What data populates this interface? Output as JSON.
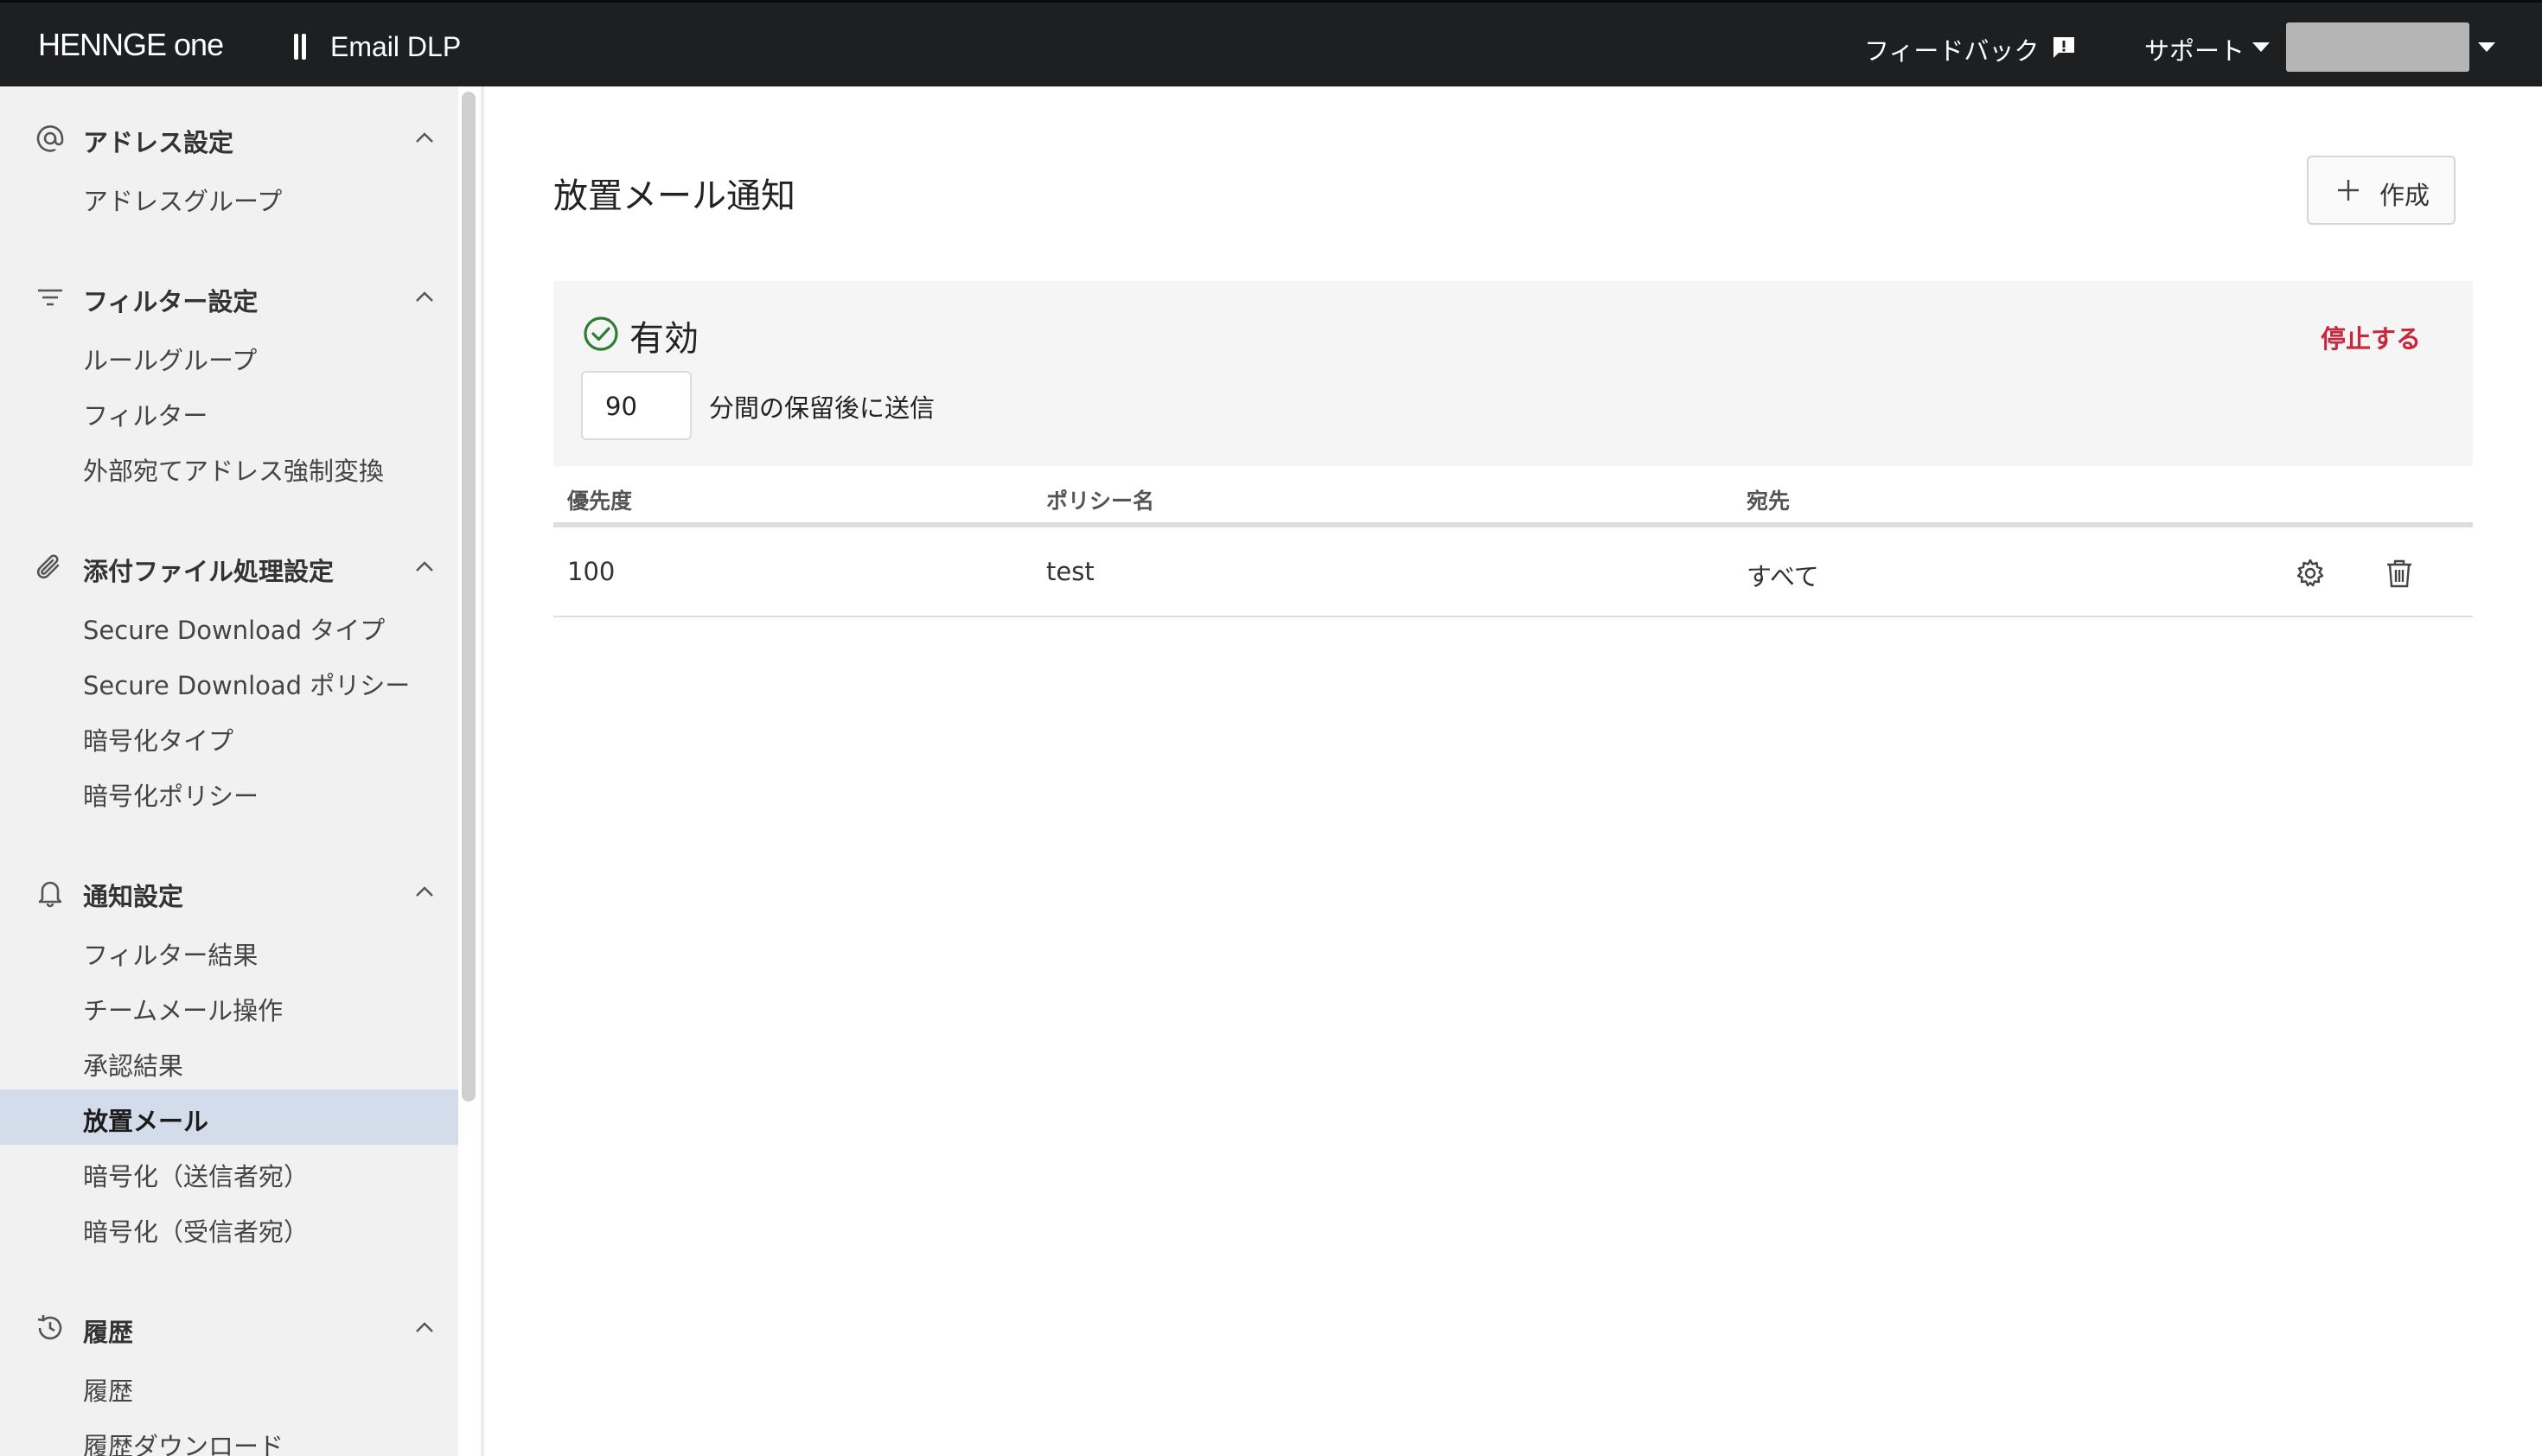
{
  "header": {
    "brand": "HENNGE one",
    "product": "Email DLP",
    "feedback_label": "フィードバック",
    "support_label": "サポート"
  },
  "sidebar": {
    "sections": [
      {
        "label": "アドレス設定",
        "icon": "at-icon",
        "items": [
          "アドレスグループ"
        ]
      },
      {
        "label": "フィルター設定",
        "icon": "filter-icon",
        "items": [
          "ルールグループ",
          "フィルター",
          "外部宛てアドレス強制変換"
        ]
      },
      {
        "label": "添付ファイル処理設定",
        "icon": "paperclip-icon",
        "items": [
          "Secure Download タイプ",
          "Secure Download ポリシー",
          "暗号化タイプ",
          "暗号化ポリシー"
        ]
      },
      {
        "label": "通知設定",
        "icon": "bell-icon",
        "items": [
          "フィルター結果",
          "チームメール操作",
          "承認結果",
          "放置メール",
          "暗号化（送信者宛）",
          "暗号化（受信者宛）"
        ]
      },
      {
        "label": "履歴",
        "icon": "history-icon",
        "items": [
          "履歴",
          "履歴ダウンロード"
        ]
      }
    ],
    "active_item": "放置メール"
  },
  "main": {
    "title": "放置メール通知",
    "create_label": "作成",
    "status": {
      "label": "有効",
      "stop_label": "停止する",
      "minutes_value": "90",
      "minutes_suffix": "分間の保留後に送信"
    },
    "table": {
      "headers": [
        "優先度",
        "ポリシー名",
        "宛先"
      ],
      "rows": [
        {
          "priority": "100",
          "policy": "test",
          "destination": "すべて"
        }
      ]
    }
  },
  "colors": {
    "topbar": "#1e1f21",
    "sidebar_bg": "#f1f1f1",
    "active_item_bg": "#d3dcea",
    "status_ok": "#2e7d32",
    "danger": "#c8283e"
  }
}
